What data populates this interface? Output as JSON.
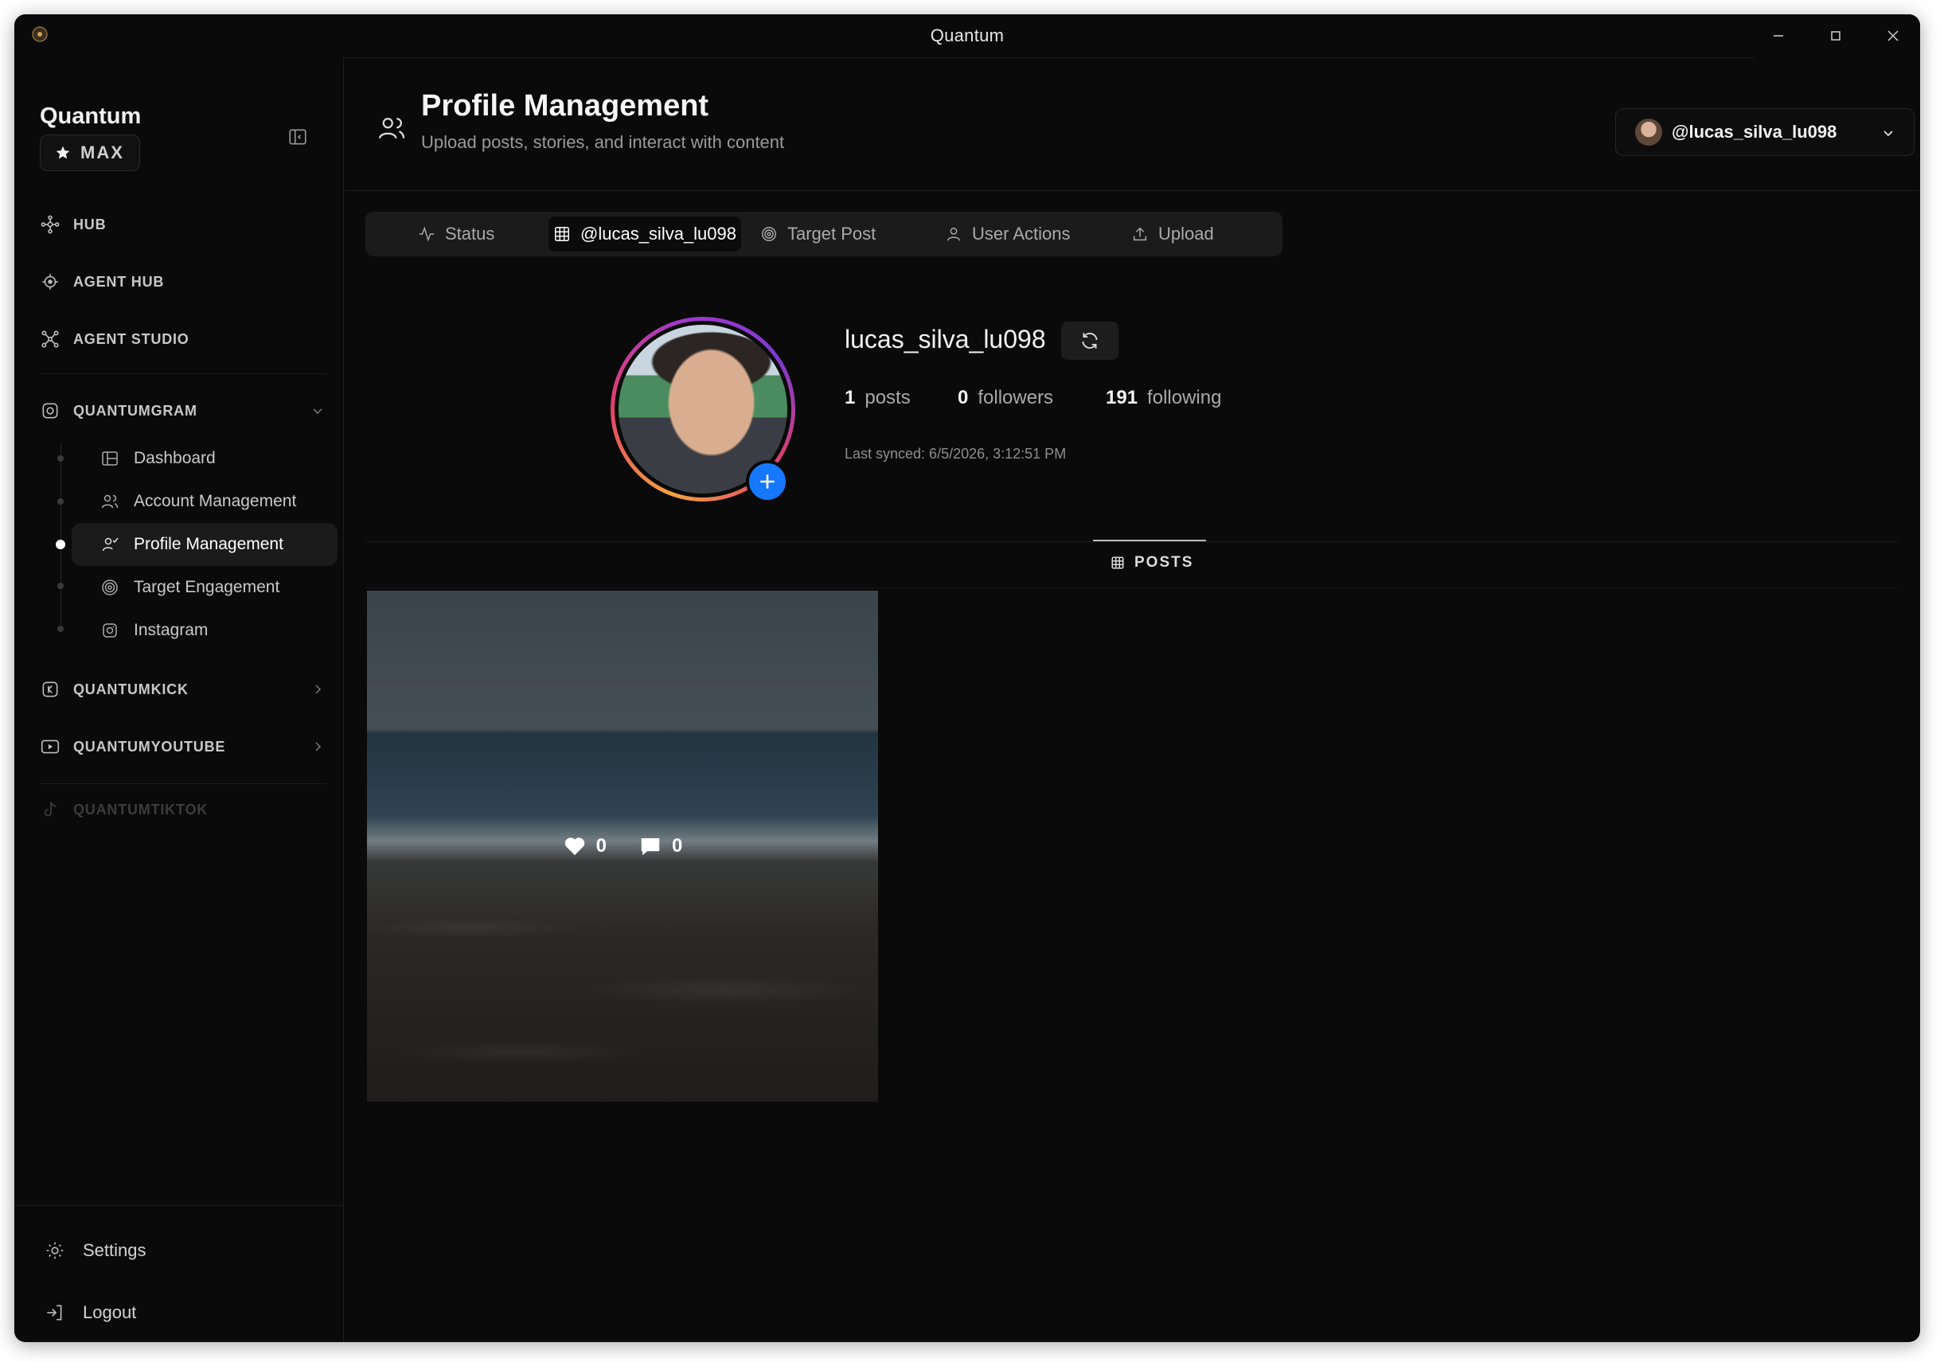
{
  "window": {
    "title": "Quantum"
  },
  "sidebar": {
    "brand": "Quantum",
    "badge": "MAX",
    "nav": [
      {
        "label": "HUB",
        "icon": "hub-icon"
      },
      {
        "label": "AGENT HUB",
        "icon": "agent-hub-icon"
      },
      {
        "label": "AGENT STUDIO",
        "icon": "agent-studio-icon"
      }
    ],
    "groups": [
      {
        "label": "QUANTUMGRAM",
        "icon": "quantumgram-icon",
        "expanded": true
      },
      {
        "label": "QUANTUMKICK",
        "icon": "quantumkick-icon",
        "expanded": false
      },
      {
        "label": "QUANTUMYOUTUBE",
        "icon": "quantumyoutube-icon",
        "expanded": false
      },
      {
        "label": "QUANTUMTIKTOK",
        "icon": "quantumtiktok-icon",
        "disabled": true
      }
    ],
    "sub_items": [
      {
        "label": "Dashboard",
        "icon": "dashboard-icon"
      },
      {
        "label": "Account Management",
        "icon": "users-icon"
      },
      {
        "label": "Profile Management",
        "icon": "profile-icon",
        "active": true
      },
      {
        "label": "Target Engagement",
        "icon": "target-icon"
      },
      {
        "label": "Instagram",
        "icon": "instagram-icon"
      }
    ],
    "footer": [
      {
        "label": "Settings",
        "icon": "gear-icon"
      },
      {
        "label": "Logout",
        "icon": "logout-icon"
      }
    ]
  },
  "header": {
    "title": "Profile Management",
    "subtitle": "Upload posts, stories, and interact with content",
    "account_selector": "@lucas_silva_lu098"
  },
  "tabs": [
    {
      "label": "Status",
      "icon": "activity-icon"
    },
    {
      "label": "@lucas_silva_lu098",
      "icon": "grid-icon",
      "active": true
    },
    {
      "label": "Target Post",
      "icon": "target-icon"
    },
    {
      "label": "User Actions",
      "icon": "user-icon"
    },
    {
      "label": "Upload",
      "icon": "upload-icon"
    }
  ],
  "profile": {
    "username": "lucas_silva_lu098",
    "posts_count": "1",
    "posts_label": "posts",
    "followers_count": "0",
    "followers_label": "followers",
    "following_count": "191",
    "following_label": "following",
    "last_synced": "Last synced: 6/5/2026, 3:12:51 PM"
  },
  "posts_section": {
    "tab_label": "POSTS",
    "posts": [
      {
        "likes": "0",
        "comments": "0"
      }
    ]
  },
  "colors": {
    "background": "#0a0a0a",
    "accent": "#1677ff",
    "active_item": "#1b1b1b"
  }
}
